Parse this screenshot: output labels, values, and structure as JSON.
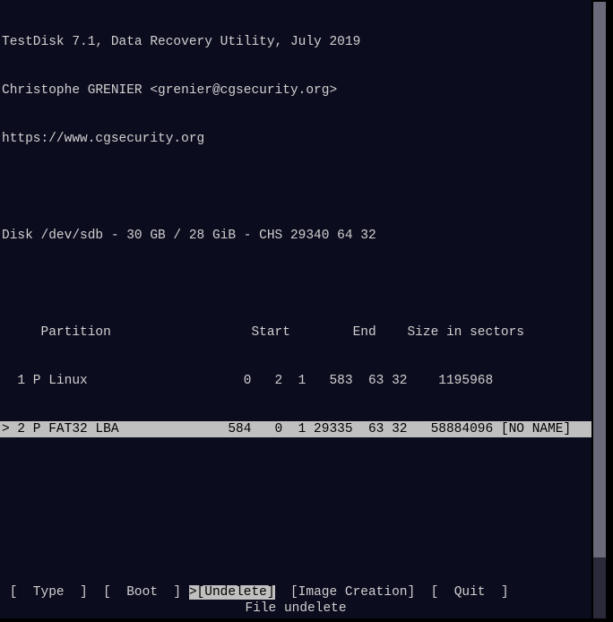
{
  "header": {
    "title": "TestDisk 7.1, Data Recovery Utility, July 2019",
    "author": "Christophe GRENIER <grenier@cgsecurity.org>",
    "url": "https://www.cgsecurity.org"
  },
  "disk": {
    "info": "Disk /dev/sdb - 30 GB / 28 GiB - CHS 29340 64 32"
  },
  "columns": {
    "header": "     Partition                  Start        End    Size in sectors"
  },
  "partitions": [
    {
      "text": "  1 P Linux                    0   2  1   583  63 32    1195968",
      "selected": false
    },
    {
      "text": "> 2 P FAT32 LBA              584   0  1 29335  63 32   58884096 [NO NAME]",
      "selected": true
    }
  ],
  "menu": {
    "prefix": " [  Type  ]  [  Boot  ] ",
    "selected": ">[Undelete]",
    "suffix": "  [Image Creation]  [  Quit  ]"
  },
  "status": "File undelete"
}
